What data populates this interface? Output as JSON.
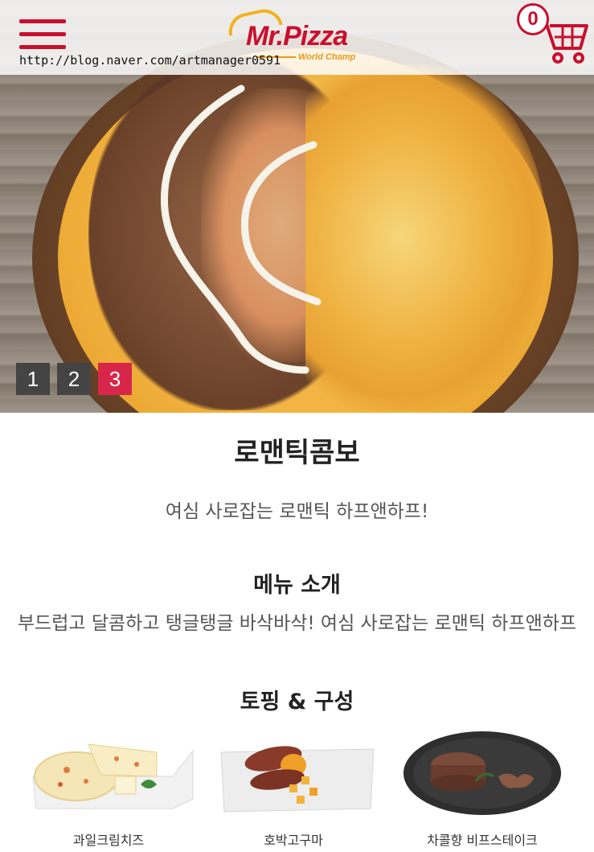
{
  "header": {
    "menu_icon": "hamburger-menu-icon",
    "logo_text": "Mr.Pizza",
    "logo_subtext": "World Champ",
    "cart_icon": "shopping-cart-icon",
    "cart_count": "0",
    "watermark": "http://blog.naver.com/artmanager0591",
    "accent_color": "#c8102e"
  },
  "slider": {
    "pages": [
      "1",
      "2",
      "3"
    ],
    "active_page": "3",
    "active_color": "#d8264a"
  },
  "product": {
    "name": "로맨틱콤보",
    "tagline": "여심 사로잡는 로맨틱 하프앤하프!"
  },
  "menu_intro": {
    "heading": "메뉴 소개",
    "text": "부드럽고 달콤하고 탱글탱글 바삭바삭! 여심 사로잡는 로맨틱 하프앤하프"
  },
  "toppings": {
    "heading": "토핑 & 구성",
    "items": [
      {
        "label": "과일크림치즈"
      },
      {
        "label": "호박고구마"
      },
      {
        "label": "차콜향 비프스테이크"
      }
    ]
  }
}
